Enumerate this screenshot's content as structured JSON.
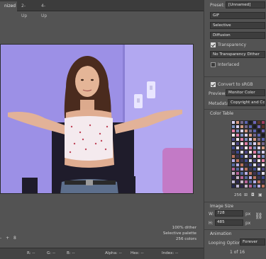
{
  "tabs": [
    "nized",
    "2-Up",
    "4-Up"
  ],
  "preview_info": {
    "dither": "100% dither",
    "palette": "Selective palette",
    "colors": "256 colors"
  },
  "zoom_controls": {
    "minus": "-",
    "plus": "+",
    "count": "8"
  },
  "status": {
    "r": "R: --",
    "g": "G: --",
    "b": "B: --",
    "alpha": "Alpha: --",
    "hex": "Hex: --",
    "index": "Index: --"
  },
  "panel": {
    "preset_label": "Preset:",
    "preset_value": "[Unnamed]",
    "format": "GIF",
    "reduction": "Selective",
    "dither_algorithm": "Diffusion",
    "transparency_label": "Transparency",
    "transparency_checked": true,
    "transparency_dither": "No Transparency Dither",
    "interlaced_label": "Interlaced",
    "interlaced_checked": false,
    "convert_srgb_label": "Convert to sRGB",
    "convert_srgb_checked": true,
    "preview_label": "Preview:",
    "preview_value": "Monitor Color",
    "metadata_label": "Metadata:",
    "metadata_value": "Copyright and Contact",
    "color_table_label": "Color Table",
    "color_count": "256",
    "image_size_label": "Image Size",
    "w_label": "W:",
    "w_value": "728",
    "h_label": "H:",
    "h_value": "485",
    "px": "px",
    "animation_label": "Animation",
    "looping_label": "Looping Options:",
    "looping_value": "Forever",
    "frame_counter": "1 of 16"
  },
  "colors": {
    "panel_bg": "#535353",
    "tab_bar": "#3c3c3c",
    "wall": "#9c90e6"
  }
}
